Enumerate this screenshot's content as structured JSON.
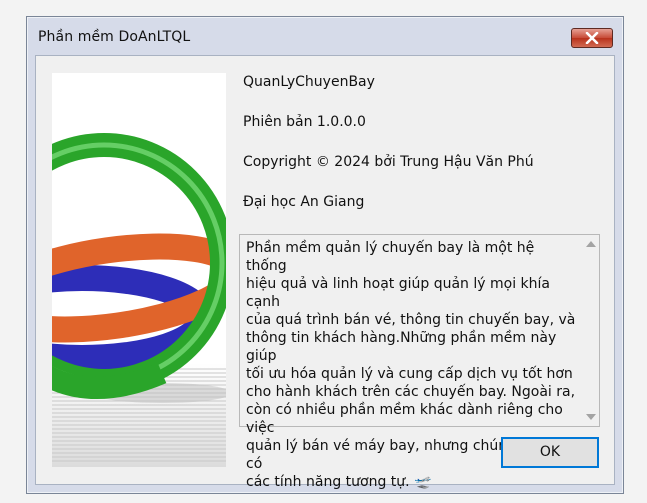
{
  "window": {
    "title": "Phần mềm DoAnLTQL"
  },
  "about": {
    "product_name": "QuanLyChuyenBay",
    "version": "Phiên bản 1.0.0.0",
    "copyright": "Copyright © 2024 bởi Trung Hậu Văn Phú",
    "company": "Đại học An Giang",
    "description": "Phần mềm quản lý chuyến bay là một hệ thống\nhiệu quả và linh hoạt giúp quản lý mọi khía cạnh\ncủa quá trình bán vé, thông tin chuyến bay, và\nthông tin khách hàng.Những phần mềm này giúp\ntối ưu hóa quản lý và cung cấp dịch vụ tốt hơn\ncho hành khách trên các chuyến bay. Ngoài ra,\ncòn có nhiều phần mềm khác dành riêng cho việc\nquản lý bán vé máy bay, nhưng chúng thường có\ncác tính năng tương tự. 🛫"
  },
  "buttons": {
    "ok": "OK"
  },
  "icons": {
    "close": "close-icon",
    "logo": "rings-logo"
  },
  "colors": {
    "ring_green": "#2aa52a",
    "ring_orange": "#e0642b",
    "ring_blue": "#2d2db8",
    "close_red": "#c74a36",
    "accent_blue": "#0078d7"
  }
}
